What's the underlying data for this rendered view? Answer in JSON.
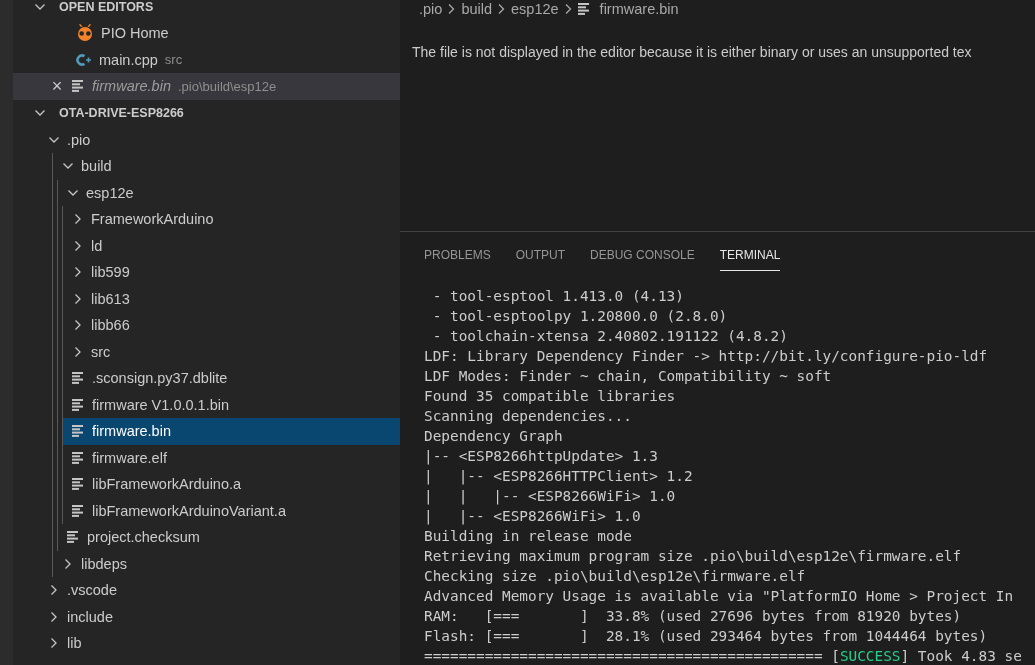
{
  "open_editors": {
    "title": "OPEN EDITORS",
    "expanded": true,
    "items": [
      {
        "name": "PIO Home",
        "kind": "pio",
        "selected": false,
        "preview": false
      },
      {
        "name": "main.cpp",
        "description": "src",
        "kind": "cpp",
        "selected": false,
        "preview": false
      },
      {
        "name": "firmware.bin",
        "description": ".pio\\build\\esp12e",
        "kind": "file",
        "selected": true,
        "preview": true,
        "close": "×"
      }
    ]
  },
  "explorer": {
    "title": "OTA-DRIVE-ESP8266",
    "expanded": true,
    "tree": [
      {
        "name": ".pio",
        "kind": "folder",
        "expanded": true,
        "selected": false,
        "children": [
          {
            "name": "build",
            "kind": "folder",
            "expanded": true,
            "selected": false,
            "children": [
              {
                "name": "esp12e",
                "kind": "folder",
                "expanded": true,
                "selected": false,
                "children": [
                  {
                    "name": "FrameworkArduino",
                    "kind": "folder",
                    "expanded": false,
                    "selected": false
                  },
                  {
                    "name": "ld",
                    "kind": "folder",
                    "expanded": false,
                    "selected": false
                  },
                  {
                    "name": "lib599",
                    "kind": "folder",
                    "expanded": false,
                    "selected": false
                  },
                  {
                    "name": "lib613",
                    "kind": "folder",
                    "expanded": false,
                    "selected": false
                  },
                  {
                    "name": "libb66",
                    "kind": "folder",
                    "expanded": false,
                    "selected": false
                  },
                  {
                    "name": "src",
                    "kind": "folder",
                    "expanded": false,
                    "selected": false
                  },
                  {
                    "name": ".sconsign.py37.dblite",
                    "kind": "file",
                    "selected": false
                  },
                  {
                    "name": "firmware V1.0.0.1.bin",
                    "kind": "file",
                    "selected": false
                  },
                  {
                    "name": "firmware.bin",
                    "kind": "file",
                    "selected": true
                  },
                  {
                    "name": "firmware.elf",
                    "kind": "file",
                    "selected": false
                  },
                  {
                    "name": "libFrameworkArduino.a",
                    "kind": "file",
                    "selected": false
                  },
                  {
                    "name": "libFrameworkArduinoVariant.a",
                    "kind": "file",
                    "selected": false
                  }
                ]
              },
              {
                "name": "project.checksum",
                "kind": "file",
                "selected": false
              }
            ]
          },
          {
            "name": "libdeps",
            "kind": "folder",
            "expanded": false,
            "selected": false
          }
        ]
      },
      {
        "name": ".vscode",
        "kind": "folder",
        "expanded": false,
        "selected": false
      },
      {
        "name": "include",
        "kind": "folder",
        "expanded": false,
        "selected": false
      },
      {
        "name": "lib",
        "kind": "folder",
        "expanded": false,
        "selected": false
      }
    ]
  },
  "editor": {
    "breadcrumbs": [
      ".pio",
      "build",
      "esp12e",
      "firmware.bin"
    ],
    "message": "The file is not displayed in the editor because it is either binary or uses an unsupported tex"
  },
  "panel": {
    "tabs": [
      {
        "label": "PROBLEMS",
        "selected": false
      },
      {
        "label": "OUTPUT",
        "selected": false
      },
      {
        "label": "DEBUG CONSOLE",
        "selected": false
      },
      {
        "label": "TERMINAL",
        "selected": true
      }
    ],
    "terminal": [
      {
        "text": " - tool-esptool 1.413.0 (4.13)"
      },
      {
        "text": " - tool-esptoolpy 1.20800.0 (2.8.0)"
      },
      {
        "text": " - toolchain-xtensa 2.40802.191122 (4.8.2)"
      },
      {
        "text": "LDF: Library Dependency Finder -> http://bit.ly/configure-pio-ldf"
      },
      {
        "text": "LDF Modes: Finder ~ chain, Compatibility ~ soft"
      },
      {
        "text": "Found 35 compatible libraries"
      },
      {
        "text": "Scanning dependencies..."
      },
      {
        "text": "Dependency Graph"
      },
      {
        "text": "|-- <ESP8266httpUpdate> 1.3"
      },
      {
        "text": "|   |-- <ESP8266HTTPClient> 1.2"
      },
      {
        "text": "|   |   |-- <ESP8266WiFi> 1.0"
      },
      {
        "text": "|   |-- <ESP8266WiFi> 1.0"
      },
      {
        "text": "Building in release mode"
      },
      {
        "text": "Retrieving maximum program size .pio\\build\\esp12e\\firmware.elf"
      },
      {
        "text": "Checking size .pio\\build\\esp12e\\firmware.elf"
      },
      {
        "text": "Advanced Memory Usage is available via \"PlatformIO Home > Project In"
      },
      {
        "text": "RAM:   [===       ]  33.8% (used 27696 bytes from 81920 bytes)"
      },
      {
        "text": "Flash: [===       ]  28.1% (used 293464 bytes from 1044464 bytes)"
      },
      {
        "parts": [
          {
            "text": "============================================== [",
            "kind": "plain"
          },
          {
            "text": "SUCCESS",
            "kind": "success"
          },
          {
            "text": "] Took 4.83 se",
            "kind": "plain"
          }
        ]
      }
    ]
  }
}
